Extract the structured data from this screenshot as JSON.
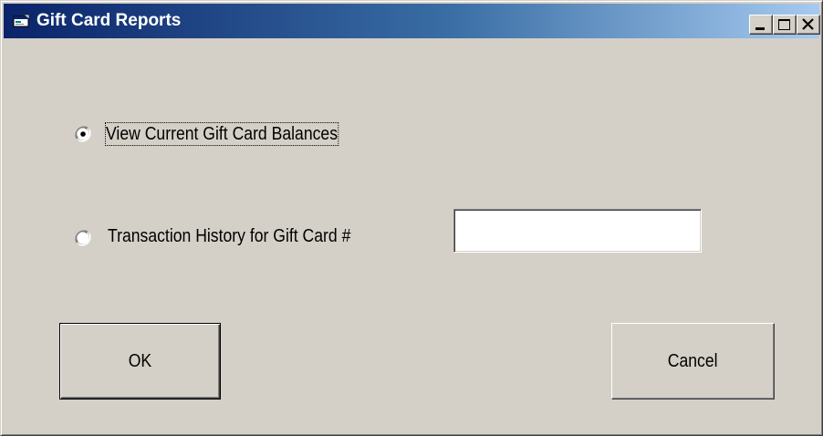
{
  "window": {
    "title": "Gift Card Reports",
    "icon": "gift-card-app-icon",
    "controls": {
      "minimize_icon": "minimize-icon",
      "maximize_icon": "maximize-icon",
      "close_icon": "close-icon"
    }
  },
  "options": {
    "selected": "view_balances",
    "view_balances": {
      "label": "View Current Gift Card Balances",
      "checked": true
    },
    "transaction_history": {
      "label": "Transaction History for Gift Card #",
      "checked": false,
      "card_number_value": "",
      "card_number_placeholder": ""
    }
  },
  "buttons": {
    "ok_label": "OK",
    "cancel_label": "Cancel"
  },
  "colors": {
    "face": "#d4d0c8",
    "title_start": "#0a246a",
    "title_end": "#a6caf0",
    "title_text": "#ffffff"
  }
}
